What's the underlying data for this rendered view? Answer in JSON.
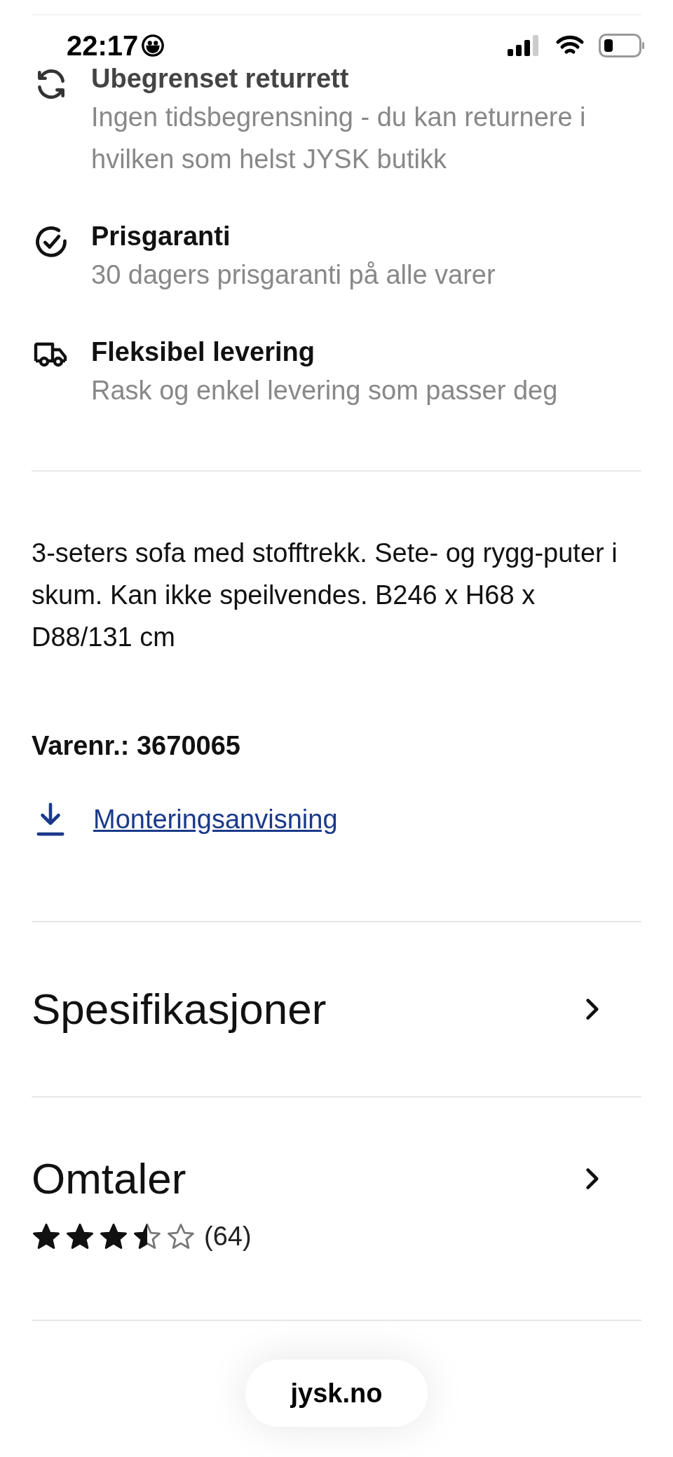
{
  "status_bar": {
    "time": "22:17"
  },
  "benefits": [
    {
      "kind": "return",
      "title": "Ubegrenset returrett",
      "text": "Ingen tidsbegrensning - du kan returnere i hvilken som helst JYSK butikk"
    },
    {
      "kind": "price",
      "title": "Prisgaranti",
      "text": "30 dagers prisgaranti på alle varer"
    },
    {
      "kind": "delivery",
      "title": "Fleksibel levering",
      "text": "Rask og enkel levering som passer deg"
    }
  ],
  "description": "3-seters sofa med stofftrekk. Sete- og rygg-puter i skum. Kan ikke speilvendes. B246 x H68 x D88/131 cm",
  "item_number": "Varenr.: 3670065",
  "assembly_link": "Monteringsanvisning",
  "sections": [
    {
      "title": "Spesifikasjoner"
    },
    {
      "title": "Omtaler",
      "stars": 3.5,
      "count": "(64)"
    }
  ],
  "address_bar": {
    "url": "jysk.no"
  }
}
